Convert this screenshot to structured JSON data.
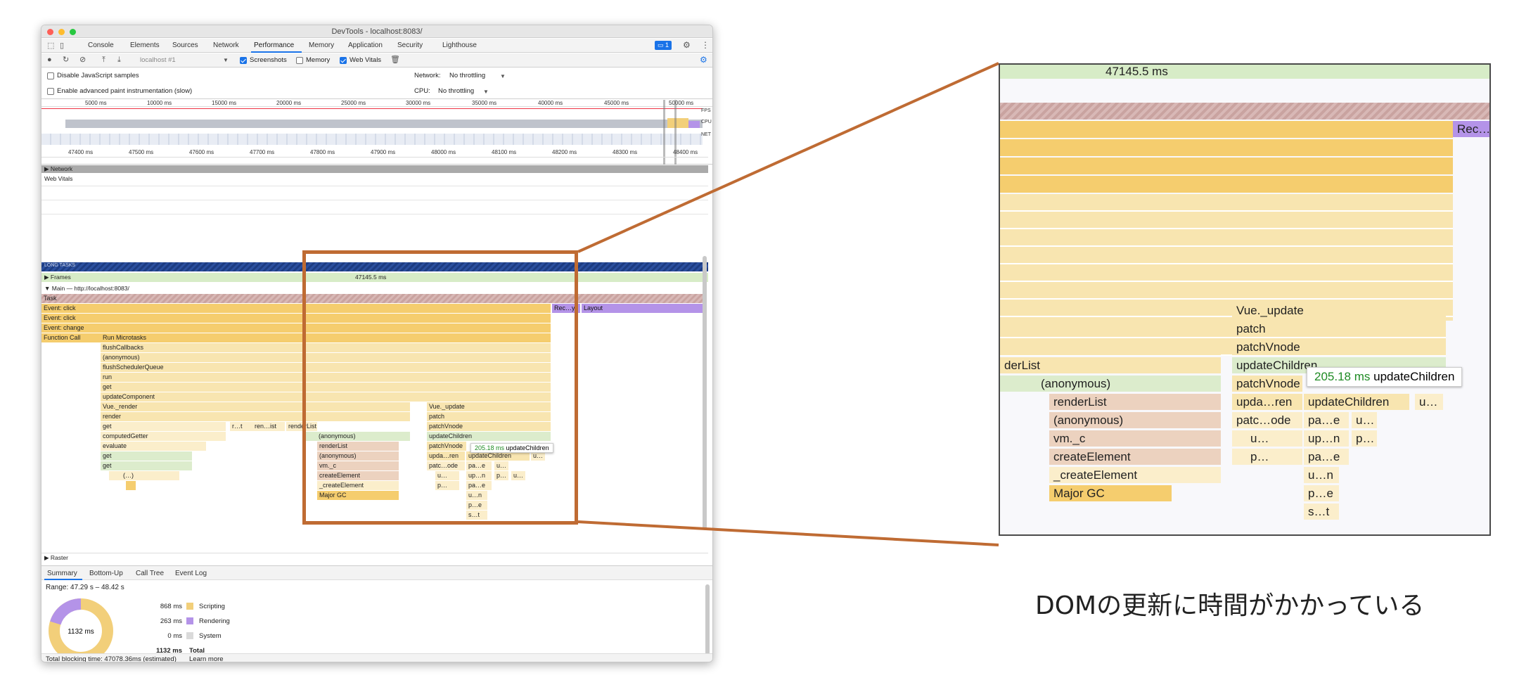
{
  "window": {
    "title": "DevTools - localhost:8083/"
  },
  "tabs": [
    "Console",
    "Elements",
    "Sources",
    "Network",
    "Performance",
    "Memory",
    "Application",
    "Security",
    "Lighthouse"
  ],
  "active_tab": "Performance",
  "issues_badge": "1",
  "toolbar": {
    "profile_select": "localhost #1",
    "screenshots": "Screenshots",
    "memory": "Memory",
    "web_vitals": "Web Vitals"
  },
  "settings": {
    "disable_js_samples": "Disable JavaScript samples",
    "advanced_paint": "Enable advanced paint instrumentation (slow)",
    "network_label": "Network:",
    "network_value": "No throttling",
    "cpu_label": "CPU:",
    "cpu_value": "No throttling"
  },
  "overview": {
    "ticks": [
      "5000 ms",
      "10000 ms",
      "15000 ms",
      "20000 ms",
      "25000 ms",
      "30000 ms",
      "35000 ms",
      "40000 ms",
      "45000 ms",
      "50000 ms"
    ],
    "lanes": [
      "FPS",
      "CPU",
      "NET"
    ]
  },
  "timeline": {
    "ticks": [
      "47400 ms",
      "47500 ms",
      "47600 ms",
      "47700 ms",
      "47800 ms",
      "47900 ms",
      "48000 ms",
      "48100 ms",
      "48200 ms",
      "48300 ms",
      "48400 ms"
    ]
  },
  "tracks": {
    "network": "Network",
    "web_vitals": "Web Vitals",
    "long_tasks": "LONG TASKS",
    "frames": "Frames",
    "frame_time": "47145.5 ms",
    "main": "Main — http://localhost:8083/",
    "raster": "Raster"
  },
  "flame": {
    "task": "Task",
    "click1": "Event: click",
    "click2": "Event: click",
    "change": "Event: change",
    "fcall": "Function Call",
    "recalc": "Rec…y",
    "layout": "Layout",
    "stack": [
      "Run Microtasks",
      "flushCallbacks",
      "(anonymous)",
      "flushSchedulerQueue",
      "run",
      "get",
      "updateComponent",
      "Vue._render",
      "render",
      "get",
      "computedGetter",
      "evaluate",
      "get",
      "get",
      "(…)"
    ],
    "r_t": "r…t",
    "ren_ist": "ren…ist",
    "renderList_top": "renderList",
    "mid": [
      "(anonymous)",
      "renderList",
      "(anonymous)",
      "vm._c",
      "createElement",
      "_createElement",
      "Major GC"
    ],
    "right": [
      "Vue._update",
      "patch",
      "patchVnode",
      "updateChildren",
      "patchVnode",
      "upda…ren",
      "patc…ode",
      "p…"
    ],
    "right2": [
      "updateChildren",
      "pa…e",
      "up…n",
      "pa…e",
      "u…n",
      "p…e",
      "s…t"
    ],
    "small": [
      "u…",
      "u…",
      "p…",
      "u…",
      "u…"
    ]
  },
  "tooltip": {
    "ms": "205.18 ms",
    "name": "updateChildren"
  },
  "summary_tabs": [
    "Summary",
    "Bottom-Up",
    "Call Tree",
    "Event Log"
  ],
  "summary": {
    "range": "Range: 47.29 s – 48.42 s",
    "total_center": "1132 ms",
    "rows": [
      {
        "value": "868 ms",
        "label": "Scripting",
        "color": "#f2cf7a"
      },
      {
        "value": "263 ms",
        "label": "Rendering",
        "color": "#b493e8"
      },
      {
        "value": "0 ms",
        "label": "System",
        "color": "#dadada"
      }
    ],
    "total_value": "1132 ms",
    "total_label": "Total"
  },
  "footer": {
    "text": "Total blocking time: 47078.36ms (estimated)",
    "link": "Learn more"
  },
  "zoom": {
    "frame_time": "47145.5 ms",
    "recalc": "Rec…y",
    "left": [
      "derList",
      "(anonymous)",
      "renderList",
      "(anonymous)",
      "vm._c",
      "createElement",
      "_createElement",
      "Major GC"
    ],
    "right": [
      "Vue._update",
      "patch",
      "patchVnode",
      "updateChildren",
      "patchVnode",
      "upda…ren",
      "patc…ode",
      "u…",
      "p…"
    ],
    "right2": [
      "updateChildren",
      "pa…e",
      "up…n",
      "pa…e",
      "u…n",
      "p…e",
      "s…t"
    ],
    "right3": [
      "u…",
      "p…",
      "u…"
    ]
  },
  "caption": "DOMの更新に時間がかかっている"
}
